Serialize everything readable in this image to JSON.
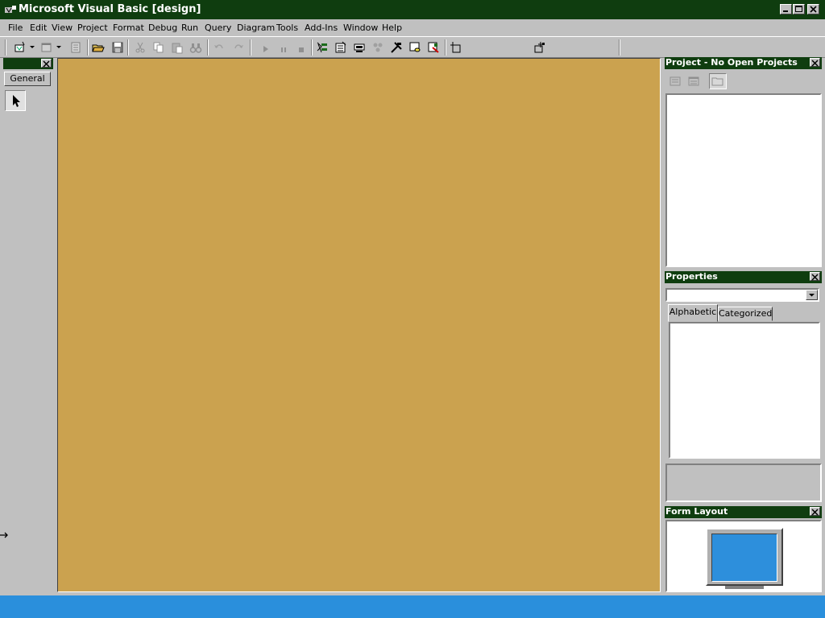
{
  "window": {
    "title": "Microsoft Visual Basic [design]"
  },
  "menu": {
    "items": [
      "File",
      "Edit",
      "View",
      "Project",
      "Format",
      "Debug",
      "Run",
      "Query",
      "Diagram",
      "Tools",
      "Add-Ins",
      "Window",
      "Help"
    ]
  },
  "toolbar": {
    "icons": [
      "add-project-icon",
      "add-form-icon",
      "menu-editor-icon",
      "open-project-icon",
      "save-project-icon",
      "cut-icon",
      "copy-icon",
      "paste-icon",
      "find-icon",
      "undo-icon",
      "redo-icon",
      "start-icon",
      "break-icon",
      "end-icon",
      "project-explorer-icon",
      "properties-window-icon",
      "form-layout-icon",
      "object-browser-icon",
      "toolbox-icon",
      "data-view-icon",
      "component-manager-icon",
      "position-icon",
      "size-icon"
    ]
  },
  "toolbox": {
    "tab_label": "General"
  },
  "project_pane": {
    "title": "Project - No Open Projects"
  },
  "properties_pane": {
    "title": "Properties",
    "tab_alphabetic": "Alphabetic",
    "tab_categorized": "Categorized"
  },
  "form_layout_pane": {
    "title": "Form Layout"
  },
  "colors": {
    "title_bar": "#0f3d0f",
    "workspace": "#cba24f",
    "taskbar": "#2a8fdc",
    "monitor_screen": "#2d8fdc"
  }
}
